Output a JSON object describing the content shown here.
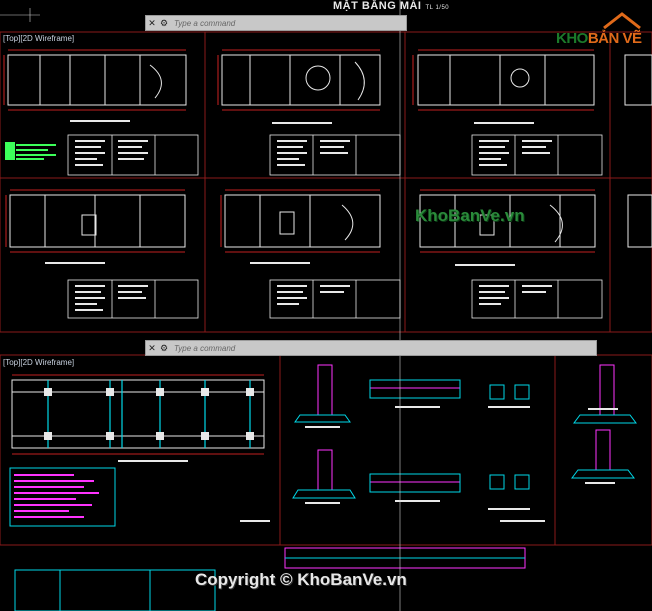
{
  "drawing_title": "MẶT BẰNG MÁI",
  "drawing_scale": "TL 1/50",
  "viewports": {
    "top_label": "[Top][2D Wireframe]",
    "bottom_label": "[Top][2D Wireframe]"
  },
  "command_bar": {
    "placeholder": "Type a command"
  },
  "logo": {
    "part1": "KHO",
    "part2": "BẢN VẼ"
  },
  "watermarks": {
    "middle": "KhoBanVe.vn",
    "copyright": "Copyright © KhoBanVe.vn"
  },
  "colors": {
    "background": "#000000",
    "wall": "#e8e8e8",
    "dimension": "#ff2b2b",
    "rebar": "#ff33ff",
    "detail_cyan": "#00d8e8",
    "annotation_green": "#3cff5a",
    "frame_border": "#8a1a1a"
  },
  "icons": {
    "close": "close-icon",
    "settings": "settings-icon"
  }
}
